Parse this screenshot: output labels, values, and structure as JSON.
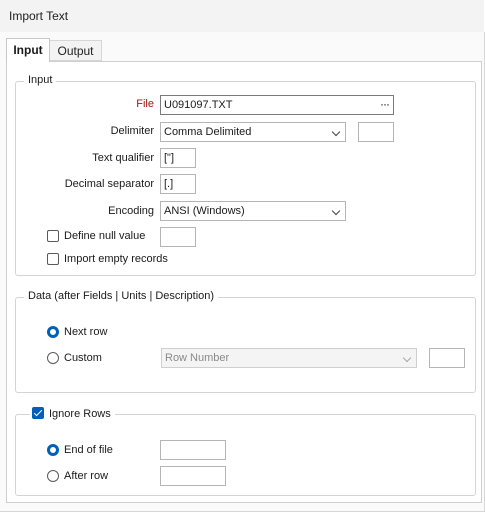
{
  "window": {
    "title": "Import Text"
  },
  "tabs": [
    {
      "label": "Input",
      "active": true
    },
    {
      "label": "Output",
      "active": false
    }
  ],
  "input_group": {
    "legend": "Input",
    "file": {
      "label": "File",
      "value": "U091097.TXT",
      "browse_icon": "ellipsis-icon",
      "label_color": "#a31515"
    },
    "delimiter": {
      "label": "Delimiter",
      "value": "Comma Delimited",
      "extra_value": ""
    },
    "text_qualifier": {
      "label": "Text qualifier",
      "value": "[\"]"
    },
    "decimal_separator": {
      "label": "Decimal separator",
      "value": "[.]"
    },
    "encoding": {
      "label": "Encoding",
      "value": "ANSI (Windows)"
    },
    "define_null_value": {
      "label": "Define null value",
      "checked": false,
      "value": ""
    },
    "import_empty_records": {
      "label": "Import empty records",
      "checked": false
    }
  },
  "data_group": {
    "legend": "Data (after Fields | Units | Description)",
    "next_row": {
      "label": "Next row",
      "selected": true
    },
    "custom": {
      "label": "Custom",
      "selected": false,
      "dropdown_value": "Row Number",
      "extra_value": ""
    }
  },
  "ignore_group": {
    "legend": "Ignore Rows",
    "checked": true,
    "end_of_file": {
      "label": "End of file",
      "selected": true,
      "value": ""
    },
    "after_row": {
      "label": "After row",
      "selected": false,
      "value": ""
    }
  },
  "colors": {
    "accent": "#005fb8",
    "required_label": "#a31515"
  }
}
